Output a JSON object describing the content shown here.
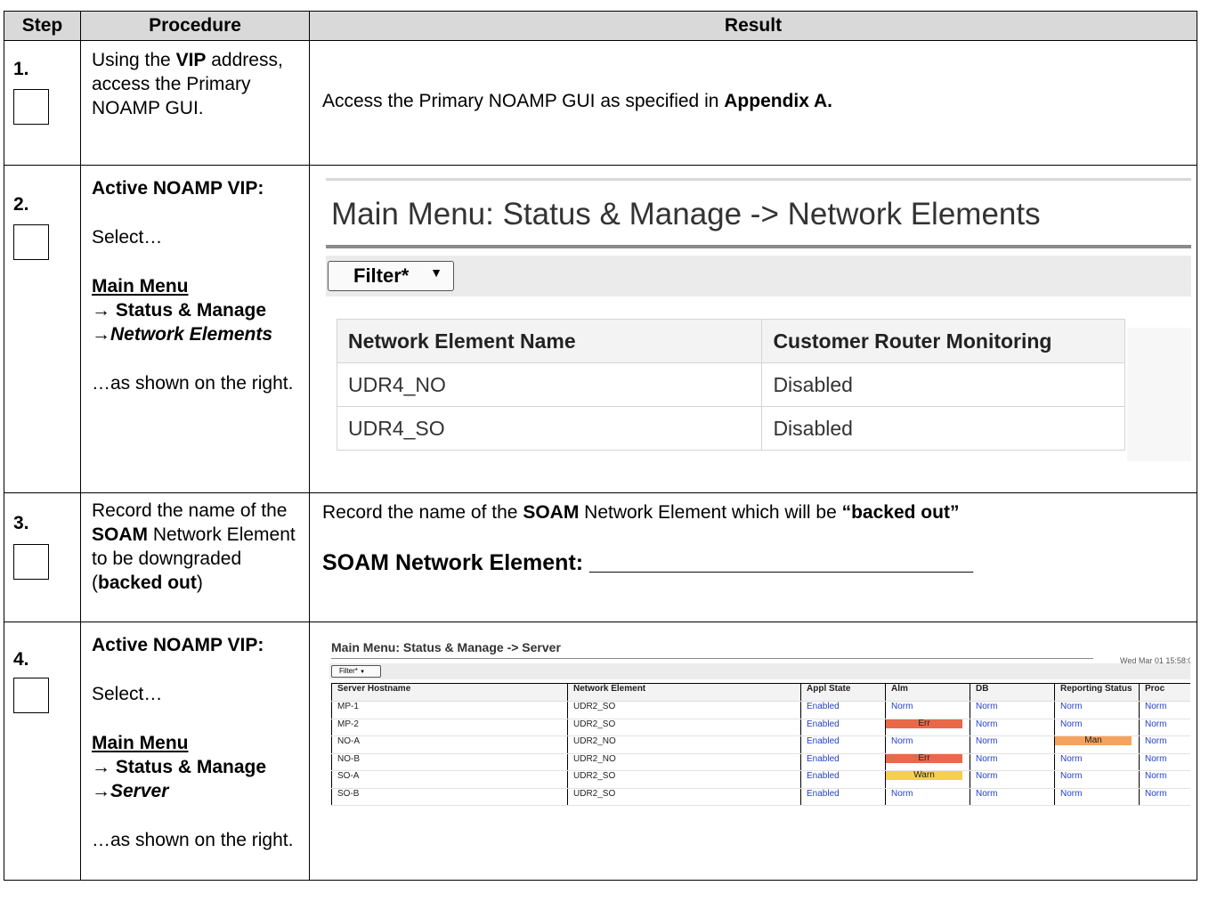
{
  "headers": {
    "step": "Step",
    "procedure": "Procedure",
    "result": "Result"
  },
  "steps": [
    {
      "num": "1.",
      "procedure": {
        "t1": "Using the ",
        "b1": "VIP",
        "t2": " address, access the Primary NOAMP GUI."
      },
      "result": {
        "t1": "Access the Primary NOAMP GUI as specified in ",
        "b1": "Appendix A."
      }
    },
    {
      "num": "2.",
      "procedure": {
        "heading": "Active NOAMP VIP:",
        "select": "Select…",
        "menu": "Main Menu",
        "sub1": "→ Status & Manage",
        "sub2": "→Network Elements",
        "shown": "…as shown on the right."
      },
      "screenshot": {
        "title": "Main Menu: Status & Manage -> Network Elements",
        "filter": "Filter*",
        "columns": [
          "Network Element Name",
          "Customer Router Monitoring"
        ],
        "rows": [
          [
            "UDR4_NO",
            "Disabled"
          ],
          [
            "UDR4_SO",
            "Disabled"
          ]
        ]
      }
    },
    {
      "num": "3.",
      "procedure": {
        "t1": "Record the name of the ",
        "b1": "SOAM",
        "t2": " Network Element to be downgraded (",
        "b2": "backed out",
        "t3": ")"
      },
      "result": {
        "t1": "Record the name of the ",
        "b1": "SOAM",
        "t2": " Network Element which will be ",
        "b2": "“backed out”",
        "label": "SOAM Network Element: _______________________________"
      }
    },
    {
      "num": "4.",
      "procedure": {
        "heading": "Active NOAMP VIP:",
        "select": "Select…",
        "menu": "Main Menu",
        "sub1": "→ Status & Manage",
        "sub2": "→Server",
        "shown": "…as shown on the right."
      },
      "screenshot": {
        "title": "Main Menu: Status & Manage -> Server",
        "date": "Wed Mar 01 15:58:0",
        "filter": "Filter*",
        "columns": [
          "Server Hostname",
          "Network Element",
          "Appl State",
          "Alm",
          "DB",
          "Reporting Status",
          "Proc"
        ],
        "rows": [
          [
            "MP-1",
            "UDR2_SO",
            "Enabled",
            "Norm",
            "Norm",
            "Norm",
            "Norm"
          ],
          [
            "MP-2",
            "UDR2_SO",
            "Enabled",
            "Err",
            "Norm",
            "Norm",
            "Norm"
          ],
          [
            "NO-A",
            "UDR2_NO",
            "Enabled",
            "Norm",
            "Norm",
            "Man",
            "Norm"
          ],
          [
            "NO-B",
            "UDR2_NO",
            "Enabled",
            "Err",
            "Norm",
            "Norm",
            "Norm"
          ],
          [
            "SO-A",
            "UDR2_SO",
            "Enabled",
            "Warn",
            "Norm",
            "Norm",
            "Norm"
          ],
          [
            "SO-B",
            "UDR2_SO",
            "Enabled",
            "Norm",
            "Norm",
            "Norm",
            "Norm"
          ]
        ],
        "status_colors": {
          "Err": "#e8694a",
          "Warn": "#f5cf4e",
          "Man": "#f4a460",
          "link": "#2440c8"
        }
      }
    }
  ]
}
